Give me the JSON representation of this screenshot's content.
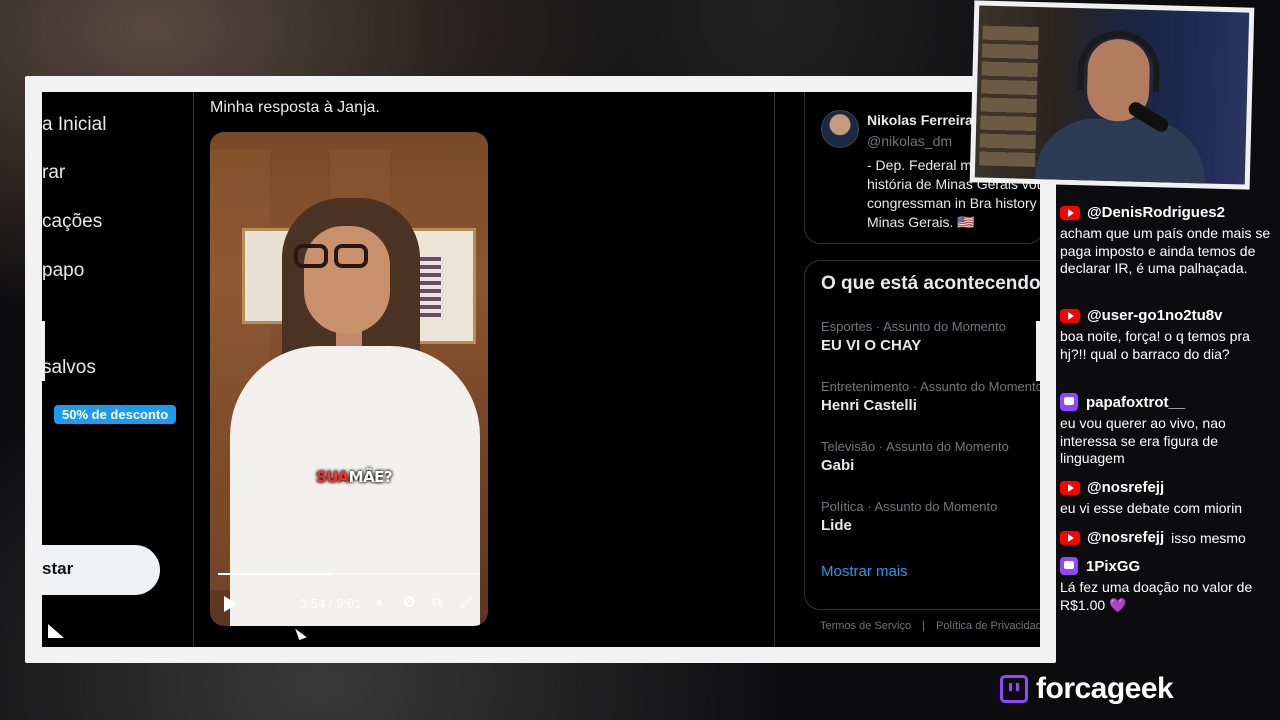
{
  "nav": {
    "items": [
      "a Inicial",
      "rar",
      "cações",
      "papo",
      "salvos"
    ],
    "promo_badge": "50% de desconto",
    "post_button": "star"
  },
  "post": {
    "text": "Minha resposta à Janja.",
    "video": {
      "caption_red": "SUA",
      "caption_white": "MÃE?",
      "time": "3:54 / 9:01",
      "progress_fraction": 0.43
    }
  },
  "profile": {
    "name": "Nikolas Ferreira",
    "handle": "@nikolas_dm",
    "bio": "- Dep. Federal mais votado da história de Minas Gerais voted congressman in Bra history of Minas Gerais. 🇺🇸"
  },
  "trends": {
    "title": "O que está acontecendo",
    "items": [
      {
        "meta": "Esportes · Assunto do Momento",
        "name": "EU VI O CHAY"
      },
      {
        "meta": "Entretenimento · Assunto do Momento",
        "name": "Henri Castelli"
      },
      {
        "meta": "Televisão · Assunto do Momento",
        "name": "Gabi"
      },
      {
        "meta": "Política · Assunto do Momento",
        "name": "Lide"
      }
    ],
    "show_more": "Mostrar mais"
  },
  "footer": {
    "links": [
      "Termos de Serviço",
      "|",
      "Política de Privacidade"
    ]
  },
  "chat": {
    "messages": [
      {
        "platform": "youtube",
        "user": "@DenisRodrigues2",
        "text": "acham que um país onde mais se paga imposto e ainda temos de declarar IR, é uma palhaçada."
      },
      {
        "platform": "youtube",
        "user": "@user-go1no2tu8v",
        "text": "boa noite, força! o q temos pra hj?!! qual o barraco do dia?"
      },
      {
        "platform": "twitch",
        "user": "papafoxtrot__",
        "text": "eu vou querer ao vivo, nao interessa se era figura de linguagem"
      },
      {
        "platform": "youtube",
        "user": "@nosrefejj",
        "text": "eu vi esse debate com miorin"
      },
      {
        "platform": "youtube",
        "user": "@nosrefejj",
        "text": "isso mesmo"
      },
      {
        "platform": "twitch",
        "user": "1PixGG",
        "text": "Lá fez uma doação no valor de R$1.00",
        "emoji": "💜"
      }
    ]
  },
  "brand": {
    "name": "forcageek"
  },
  "colors": {
    "accent": "#1d9bf0",
    "twitch": "#9146ff",
    "youtube": "#ff0000"
  }
}
